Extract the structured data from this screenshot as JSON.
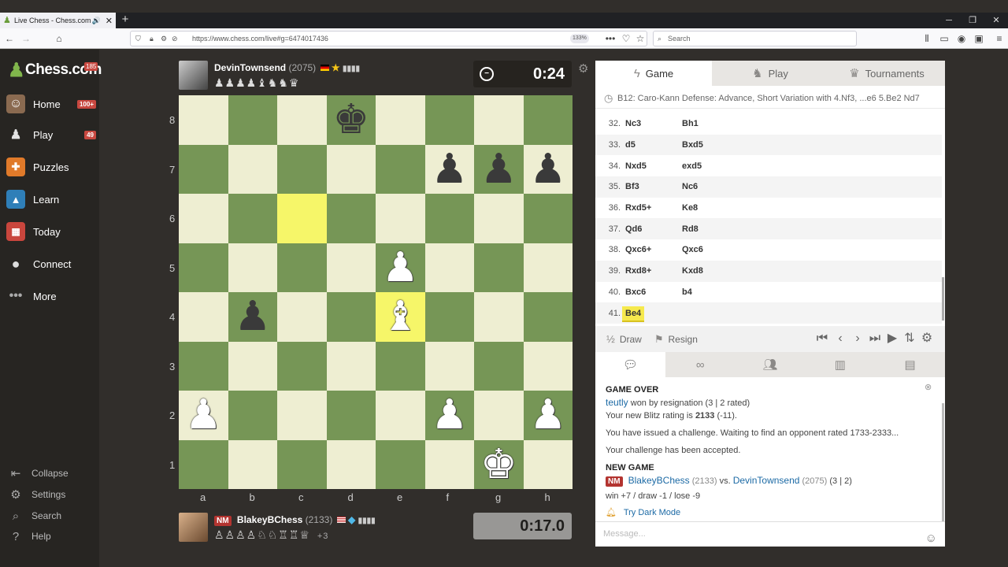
{
  "browser": {
    "tab_title": "Live Chess - Chess.com",
    "url": "https://www.chess.com/live#g=6474017436",
    "zoom": "133%",
    "search_placeholder": "Search"
  },
  "sidebar": {
    "brand": "Chess.com",
    "brand_badge": "185",
    "items": [
      {
        "label": "Home",
        "badge": "100+",
        "icon": "home-avatar"
      },
      {
        "label": "Play",
        "badge": "49",
        "icon": "play-pawn-icon"
      },
      {
        "label": "Puzzles",
        "badge": "",
        "icon": "puzzle-icon"
      },
      {
        "label": "Learn",
        "badge": "",
        "icon": "learn-icon"
      },
      {
        "label": "Today",
        "badge": "",
        "icon": "today-icon"
      },
      {
        "label": "Connect",
        "badge": "",
        "icon": "connect-icon"
      },
      {
        "label": "More",
        "badge": "",
        "icon": "more-icon"
      }
    ],
    "bottom": [
      {
        "label": "Collapse",
        "icon": "collapse-icon"
      },
      {
        "label": "Settings",
        "icon": "gear-icon"
      },
      {
        "label": "Search",
        "icon": "search-icon"
      },
      {
        "label": "Help",
        "icon": "help-icon"
      }
    ]
  },
  "top_player": {
    "name": "DevinTownsend",
    "rating": "(2075)",
    "captured": "♟♟♟♟♝♞♞♛",
    "clock": "0:24"
  },
  "bottom_player": {
    "title": "NM",
    "name": "BlakeyBChess",
    "rating": "(2133)",
    "captured": "♙♙♙♙♘♘♖♖♕",
    "advantage": "+3",
    "clock": "0:17.0"
  },
  "board": {
    "files": [
      "a",
      "b",
      "c",
      "d",
      "e",
      "f",
      "g",
      "h"
    ],
    "ranks": [
      "8",
      "7",
      "6",
      "5",
      "4",
      "3",
      "2",
      "1"
    ],
    "pieces": {
      "d8": "bk",
      "f7": "bp",
      "g7": "bp",
      "h7": "bp",
      "e5": "wp",
      "b4": "bp",
      "e4": "wb",
      "a2": "wp",
      "f2": "wp",
      "h2": "wp",
      "g1": "wk"
    },
    "highlights": [
      "c6",
      "e4"
    ]
  },
  "panel": {
    "tabs": [
      "Game",
      "Play",
      "Tournaments"
    ],
    "opening": "B12: Caro-Kann Defense: Advance, Short Variation with 4.Nf3, ...e6 5.Be2 Nd7",
    "moves": [
      {
        "n": "32.",
        "w": "Nc3",
        "b": "Bh1"
      },
      {
        "n": "33.",
        "w": "d5",
        "b": "Bxd5"
      },
      {
        "n": "34.",
        "w": "Nxd5",
        "b": "exd5"
      },
      {
        "n": "35.",
        "w": "Bf3",
        "b": "Nc6"
      },
      {
        "n": "36.",
        "w": "Rxd5+",
        "b": "Ke8"
      },
      {
        "n": "37.",
        "w": "Qd6",
        "b": "Rd8"
      },
      {
        "n": "38.",
        "w": "Qxc6+",
        "b": "Qxc6"
      },
      {
        "n": "39.",
        "w": "Rxd8+",
        "b": "Kxd8"
      },
      {
        "n": "40.",
        "w": "Bxc6",
        "b": "b4"
      },
      {
        "n": "41.",
        "w": "Be4",
        "b": ""
      }
    ],
    "draw_label": "Draw",
    "resign_label": "Resign"
  },
  "chat": {
    "game_over": "GAME OVER",
    "winner": "teutly",
    "won_text": "won by resignation (3 | 2 rated)",
    "rating_prefix": "Your new Blitz rating is",
    "rating_value": "2133",
    "rating_change": "(-11).",
    "challenge_issued": "You have issued a challenge. Waiting to find an opponent rated 1733-2333...",
    "challenge_accepted": "Your challenge has been accepted.",
    "new_game": "NEW GAME",
    "ng_title": "NM",
    "ng_white": "BlakeyBChess",
    "ng_white_rating": "(2133)",
    "ng_vs": "vs.",
    "ng_black": "DevinTownsend",
    "ng_black_rating": "(2075)",
    "ng_tc": "(3 | 2)",
    "stakes": "win +7 / draw -1 / lose -9",
    "dark_mode": "Try Dark Mode",
    "message_placeholder": "Message..."
  }
}
